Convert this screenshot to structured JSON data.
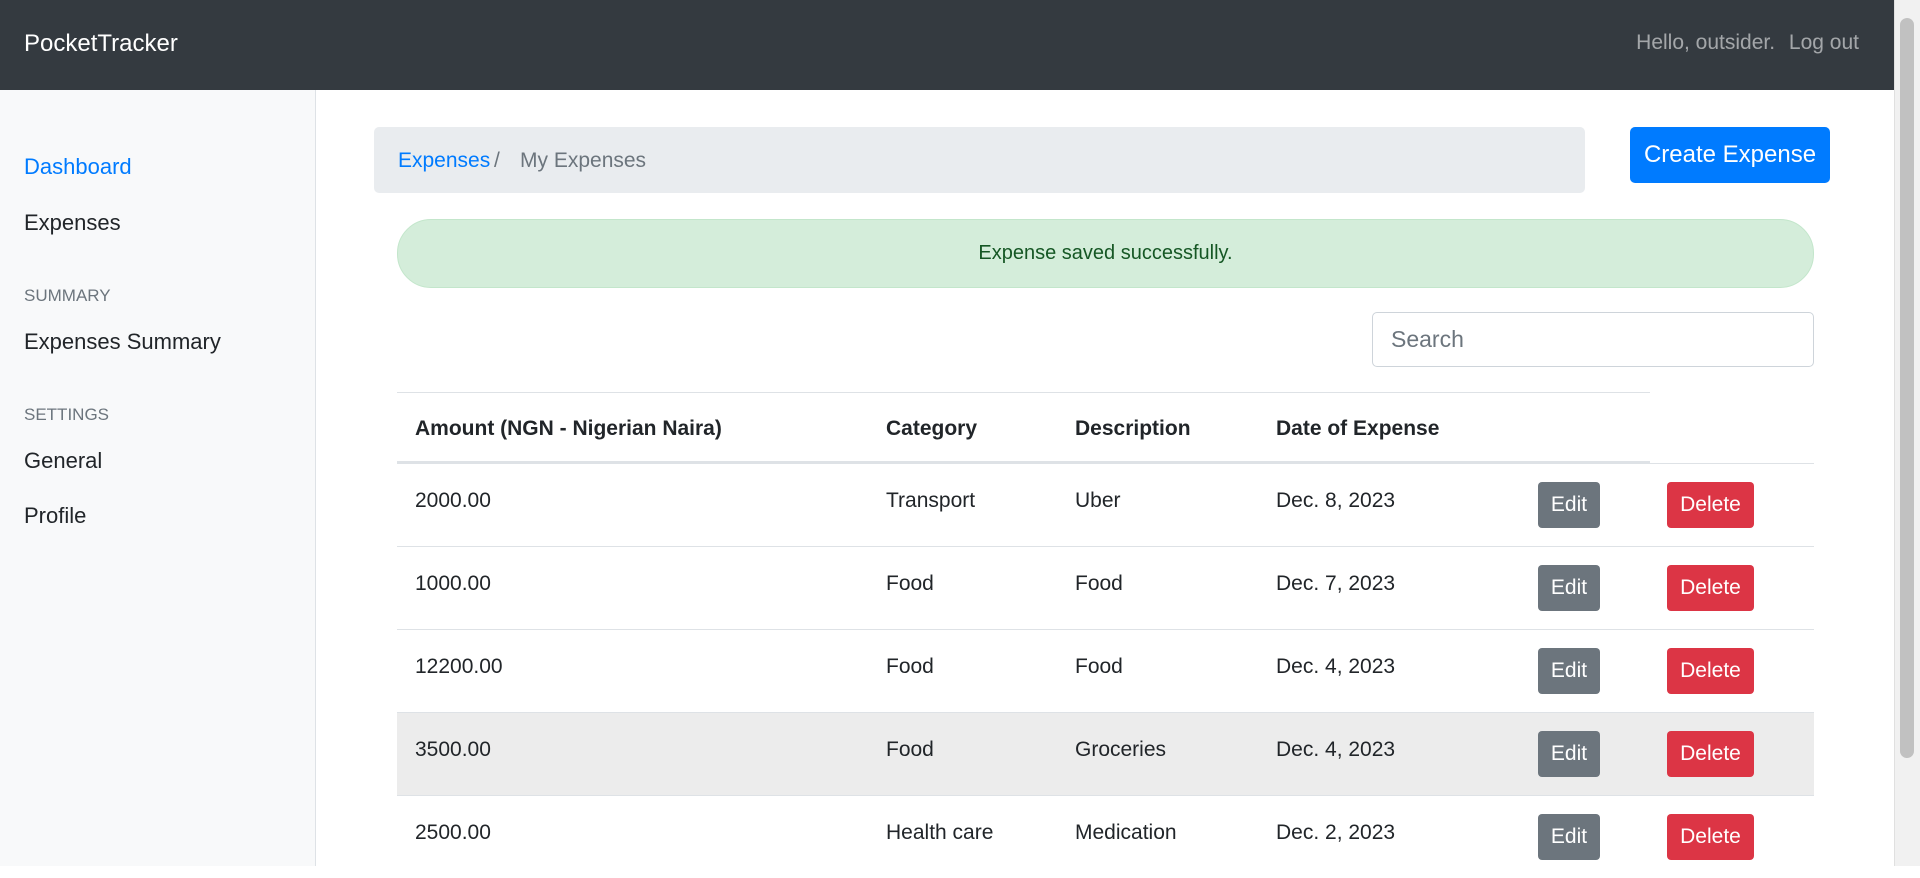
{
  "navbar": {
    "brand": "PocketTracker",
    "greeting": "Hello, outsider.",
    "logout": "Log out"
  },
  "sidebar": {
    "dashboard": "Dashboard",
    "expenses": "Expenses",
    "summary_heading": "SUMMARY",
    "expenses_summary": "Expenses Summary",
    "settings_heading": "SETTINGS",
    "general": "General",
    "profile": "Profile"
  },
  "breadcrumb": {
    "root": "Expenses",
    "separator": "/",
    "current": "My Expenses"
  },
  "create_button": "Create Expense",
  "alert": "Expense saved successfully.",
  "search": {
    "placeholder": "Search"
  },
  "table": {
    "headers": {
      "amount": "Amount (NGN - Nigerian Naira)",
      "category": "Category",
      "description": "Description",
      "date": "Date of Expense"
    },
    "edit_label": "Edit",
    "delete_label": "Delete",
    "rows": [
      {
        "amount": "2000.00",
        "category": "Transport",
        "description": "Uber",
        "date": "Dec. 8, 2023"
      },
      {
        "amount": "1000.00",
        "category": "Food",
        "description": "Food",
        "date": "Dec. 7, 2023"
      },
      {
        "amount": "12200.00",
        "category": "Food",
        "description": "Food",
        "date": "Dec. 4, 2023"
      },
      {
        "amount": "3500.00",
        "category": "Food",
        "description": "Groceries",
        "date": "Dec. 4, 2023"
      },
      {
        "amount": "2500.00",
        "category": "Health care",
        "description": "Medication",
        "date": "Dec. 2, 2023"
      }
    ]
  },
  "colors": {
    "navbar": "#343a40",
    "primary": "#007bff",
    "success_bg": "#d4edda",
    "danger": "#dc3545",
    "secondary": "#6c757d"
  }
}
